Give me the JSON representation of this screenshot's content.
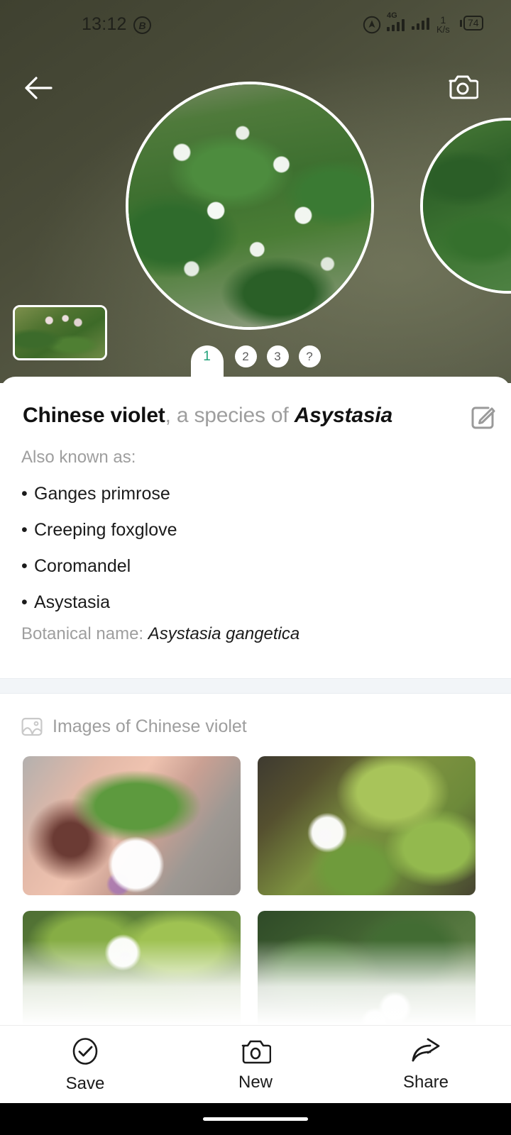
{
  "status_bar": {
    "time": "13:12",
    "bluetooth_badge": "B",
    "network_type": "4G",
    "data_rate_value": "1",
    "data_rate_unit": "K/s",
    "battery_percent": "74",
    "icons": [
      "location-icon",
      "signal-4g-icon",
      "signal-icon",
      "battery-icon"
    ]
  },
  "hero": {
    "back_icon": "back-arrow-icon",
    "camera_icon": "camera-icon",
    "thumbnail_name": "previous-capture-thumbnail",
    "main_photo_name": "identified-plant-photo",
    "next_photo_name": "next-plant-photo"
  },
  "tabs": {
    "items": [
      {
        "label": "1",
        "active": true
      },
      {
        "label": "2",
        "active": false
      },
      {
        "label": "3",
        "active": false
      },
      {
        "label": "?",
        "active": false
      }
    ]
  },
  "card": {
    "title_main": "Chinese violet",
    "title_middle": ", a species of ",
    "title_genus": "Asystasia",
    "edit_icon": "edit-pencil-icon",
    "also_known_label": "Also known as:",
    "also_known_as": [
      "Ganges primrose",
      "Creeping foxglove",
      "Coromandel",
      "Asystasia"
    ],
    "botanical_label": "Botanical name: ",
    "botanical_value": "Asystasia gangetica"
  },
  "images_section": {
    "icon": "image-icon",
    "heading": "Images of Chinese violet",
    "thumbnails": [
      {
        "name": "plant-image-1"
      },
      {
        "name": "plant-image-2"
      },
      {
        "name": "plant-image-3"
      },
      {
        "name": "plant-image-4"
      }
    ]
  },
  "bottom_bar": {
    "items": [
      {
        "label": "Save",
        "icon": "check-circle-icon"
      },
      {
        "label": "New",
        "icon": "camera-icon"
      },
      {
        "label": "Share",
        "icon": "share-arrow-icon"
      }
    ]
  },
  "colors": {
    "accent_teal": "#20a179",
    "background_olive": "#4a4c39",
    "muted_text": "#9e9e9e",
    "text": "#1b1b1b"
  }
}
